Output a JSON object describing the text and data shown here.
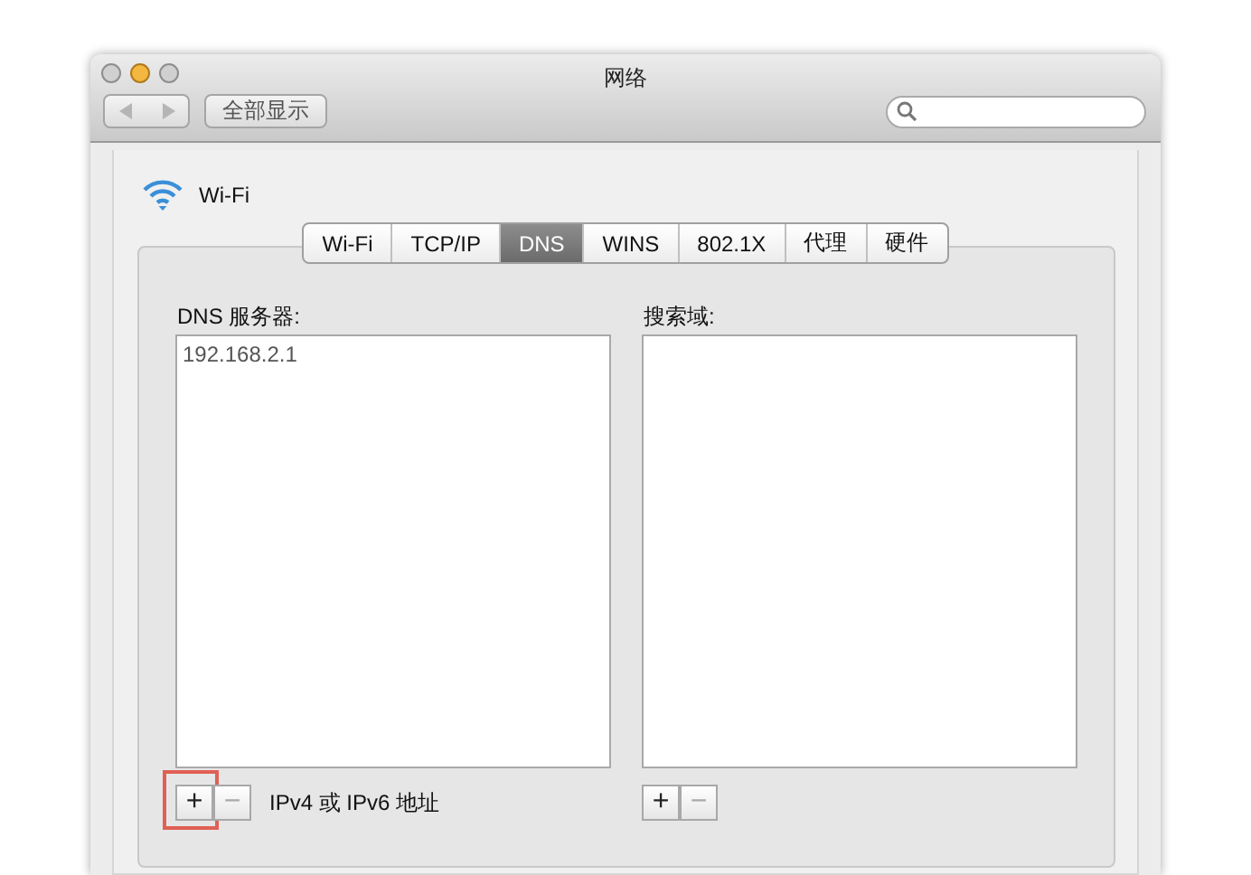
{
  "window": {
    "title": "网络"
  },
  "toolbar": {
    "show_all_button": "全部显示"
  },
  "interface": {
    "name": "Wi-Fi"
  },
  "tabs": [
    {
      "label": "Wi-Fi",
      "selected": false
    },
    {
      "label": "TCP/IP",
      "selected": false
    },
    {
      "label": "DNS",
      "selected": true
    },
    {
      "label": "WINS",
      "selected": false
    },
    {
      "label": "802.1X",
      "selected": false
    },
    {
      "label": "代理",
      "selected": false
    },
    {
      "label": "硬件",
      "selected": false
    }
  ],
  "dns_servers": {
    "label": "DNS 服务器:",
    "entries": [
      "192.168.2.1"
    ],
    "add_button": {
      "label": "+",
      "disabled": false,
      "highlighted": true
    },
    "remove_button": {
      "label": "−",
      "disabled": true
    },
    "hint": "IPv4 或 IPv6 地址"
  },
  "search_domains": {
    "label": "搜索域:",
    "add_button": {
      "label": "+",
      "disabled": false,
      "highlighted": false
    },
    "remove_button": {
      "label": "−",
      "disabled": true
    }
  }
}
